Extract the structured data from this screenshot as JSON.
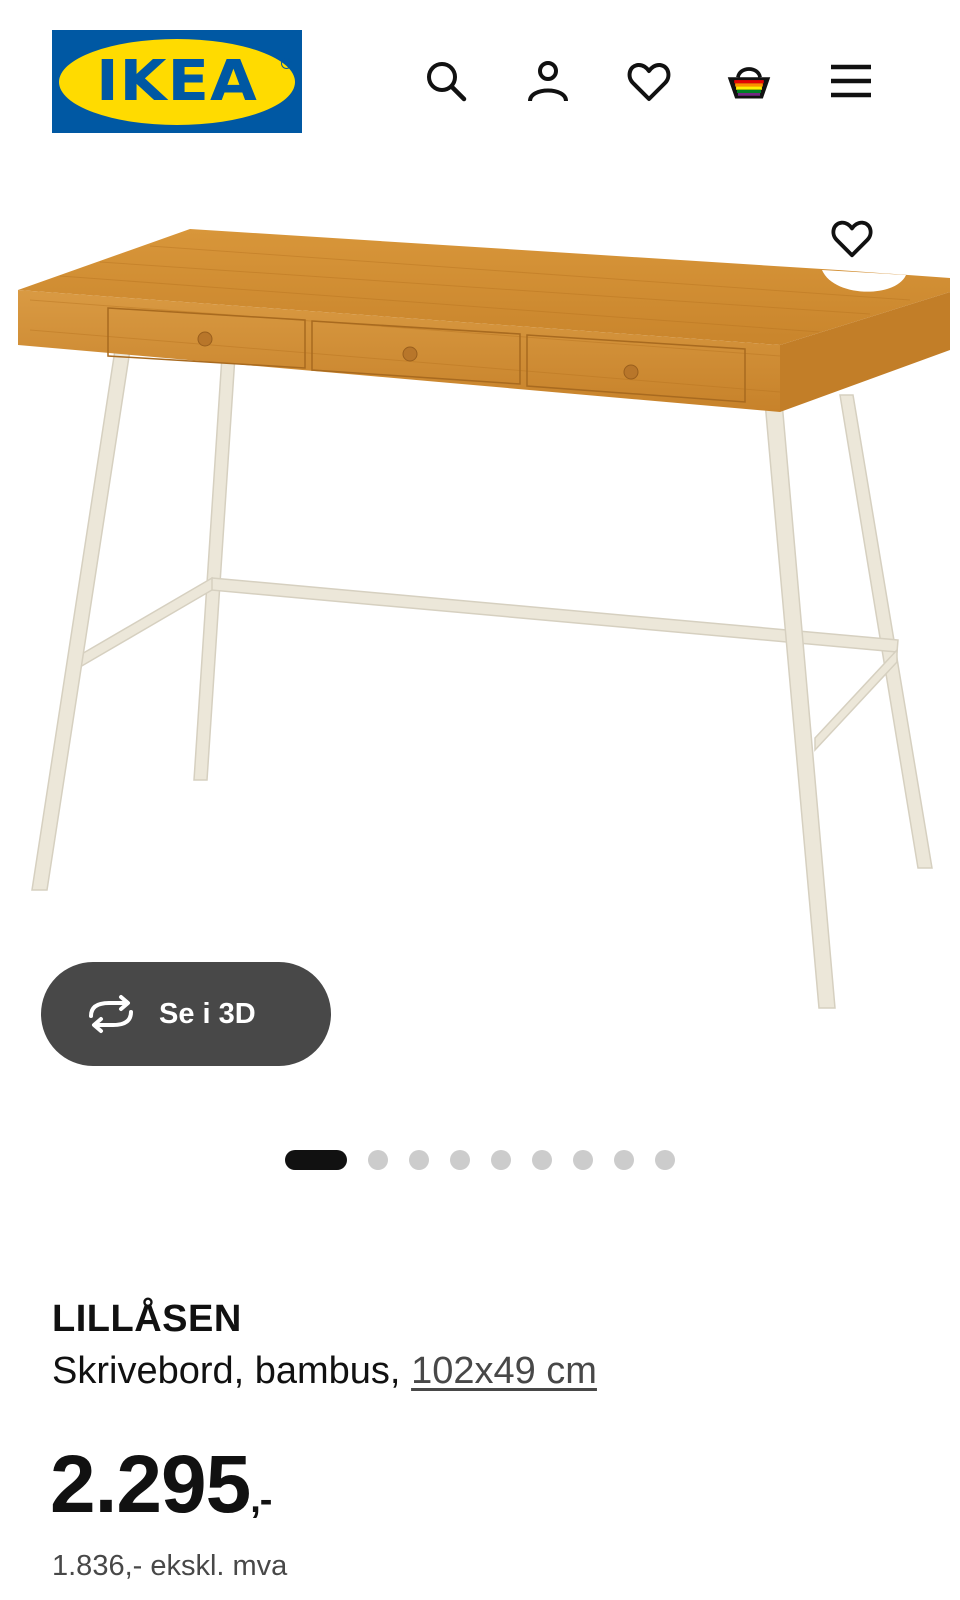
{
  "header": {
    "logo_text": "IKEA",
    "icons": [
      "search-icon",
      "user-icon",
      "heart-icon",
      "basket-icon",
      "menu-icon"
    ]
  },
  "product": {
    "name": "LILLÅSEN",
    "description_prefix": "Skrivebord, bambus, ",
    "dimensions_link": "102x49 cm",
    "price_main": "2.295",
    "price_suffix": ",-",
    "price_ex_vat": "1.836,- ekskl. mva"
  },
  "media": {
    "view_3d_label": "Se i 3D",
    "image_count": 9,
    "active_index": 0
  },
  "colors": {
    "ikea_blue": "#0058a3",
    "ikea_yellow": "#ffdb00",
    "button_dark": "#484848",
    "dot_inactive": "#cccccc",
    "dot_active": "#111111"
  }
}
